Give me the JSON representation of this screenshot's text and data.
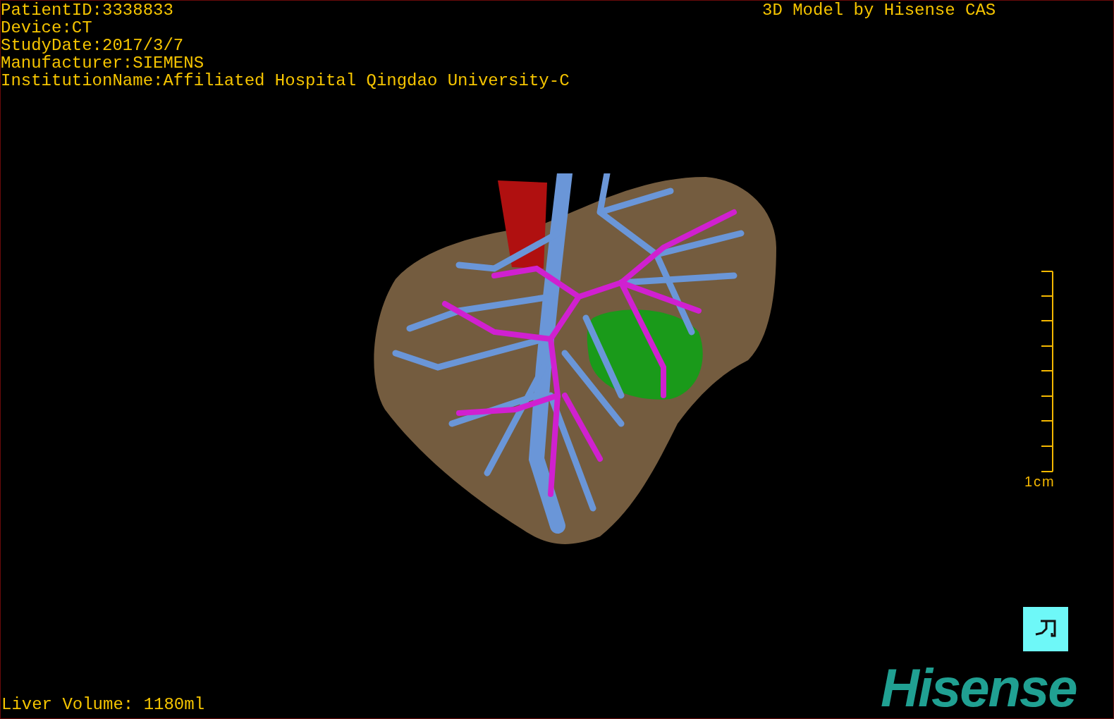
{
  "patient_info": [
    "PatientID:3338833",
    "Device:CT",
    "StudyDate:2017/3/7",
    "Manufacturer:SIEMENS",
    "InstitutionName:Affiliated Hospital Qingdao University-C"
  ],
  "model_credit": "3D Model by Hisense CAS",
  "scale_bar": {
    "label": "1cm"
  },
  "liver_volume": "Liver Volume: 1180ml",
  "logo": "Hisense"
}
